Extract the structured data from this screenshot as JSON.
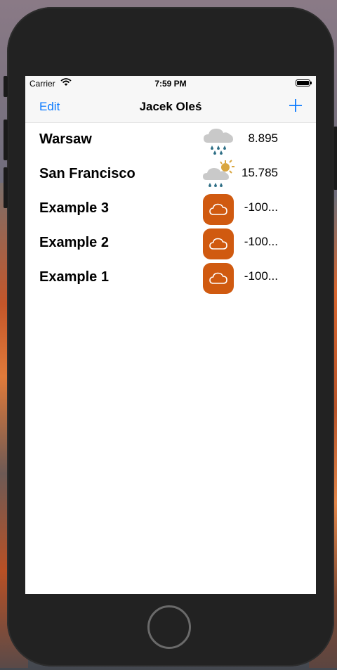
{
  "status_bar": {
    "carrier": "Carrier",
    "time": "7:59 PM",
    "wifi_icon": "wifi-icon",
    "battery_icon": "battery-icon"
  },
  "nav": {
    "edit_label": "Edit",
    "title": "Jacek Oleś",
    "add_icon": "plus-icon",
    "accent_color": "#0a7aff"
  },
  "cities": [
    {
      "name": "Warsaw",
      "icon": "rain-cloud-icon",
      "temp": "8.895"
    },
    {
      "name": "San Francisco",
      "icon": "partly-cloudy-rain-icon",
      "temp": "15.785"
    },
    {
      "name": "Example 3",
      "icon": "placeholder-cloud-icon",
      "temp": "-100..."
    },
    {
      "name": "Example 2",
      "icon": "placeholder-cloud-icon",
      "temp": "-100..."
    },
    {
      "name": "Example 1",
      "icon": "placeholder-cloud-icon",
      "temp": "-100..."
    }
  ],
  "colors": {
    "placeholder_icon_bg": "#d05a10",
    "rain_drop": "#2f6f86",
    "cloud": "#c9c9c9",
    "sun": "#d9a640"
  }
}
